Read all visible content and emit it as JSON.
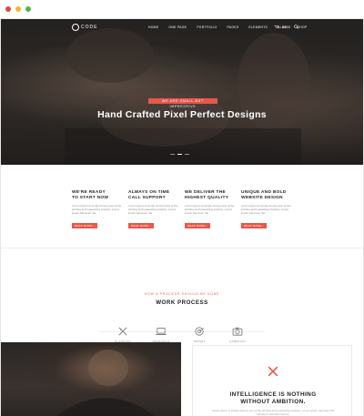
{
  "window": {
    "controls": [
      "close",
      "minimize",
      "maximize"
    ]
  },
  "colors": {
    "accent": "#e8574a",
    "hero_bg": "#2b2826",
    "text_dark": "#222222",
    "text_muted": "#888888"
  },
  "brand": {
    "logo_text": "CODE"
  },
  "nav": {
    "items": [
      "HOME",
      "ONE PAGE",
      "PORTFOLIO",
      "PAGES",
      "ELEMENTS",
      "BLOG",
      "SHOP"
    ],
    "cart_label": "$0.00",
    "icons": [
      "cart-icon",
      "search-icon"
    ]
  },
  "hero": {
    "tagline": "WE ARE SMALL BUT IMPRESSIVE",
    "title": "Hand Crafted Pixel Perfect Designs",
    "slides_total": 3,
    "slide_active": 2
  },
  "features": [
    {
      "title_line1": "WE'RE READY",
      "title_line2": "TO START NOW",
      "text": "Lorem ipsum is simply dummy text of the printing and typesetting industry. Lorem ipsum has been the",
      "button": "READ MORE"
    },
    {
      "title_line1": "ALWAYS ON TIME",
      "title_line2": "CALL SUPPORT",
      "text": "Lorem ipsum is simply dummy text of the printing and typesetting industry. Lorem ipsum has been the",
      "button": "READ MORE"
    },
    {
      "title_line1": "WE DELIVER THE",
      "title_line2": "HIGHEST QUALITY",
      "text": "Lorem ipsum is simply dummy text of the printing and typesetting industry. Lorem ipsum has been the",
      "button": "READ MORE"
    },
    {
      "title_line1": "UNIQUE AND BOLD",
      "title_line2": "WEBSITE DESIGN",
      "text": "Lorem ipsum is simply dummy text of the printing and typesetting industry. Lorem ipsum has been the",
      "button": "READ MORE"
    }
  ],
  "process": {
    "kicker": "HOW A PROCESS SHOULD BE DONE",
    "title": "WORK PROCESS",
    "steps": [
      {
        "label": "PLANNING",
        "icon": "pencil-ruler-icon"
      },
      {
        "label": "RESEARCH",
        "icon": "laptop-icon"
      },
      {
        "label": "TARGET",
        "icon": "target-icon"
      },
      {
        "label": "CAMPAIGN",
        "icon": "camera-icon"
      }
    ]
  },
  "promo": {
    "title_line1": "INTELLIGENCE IS NOTHING",
    "title_line2": "WITHOUT AMBITION.",
    "text": "Lorem ipsum is simply dummy text of the printing and typesetting industry. Lorem ipsum has been the industry's standard dummy"
  }
}
